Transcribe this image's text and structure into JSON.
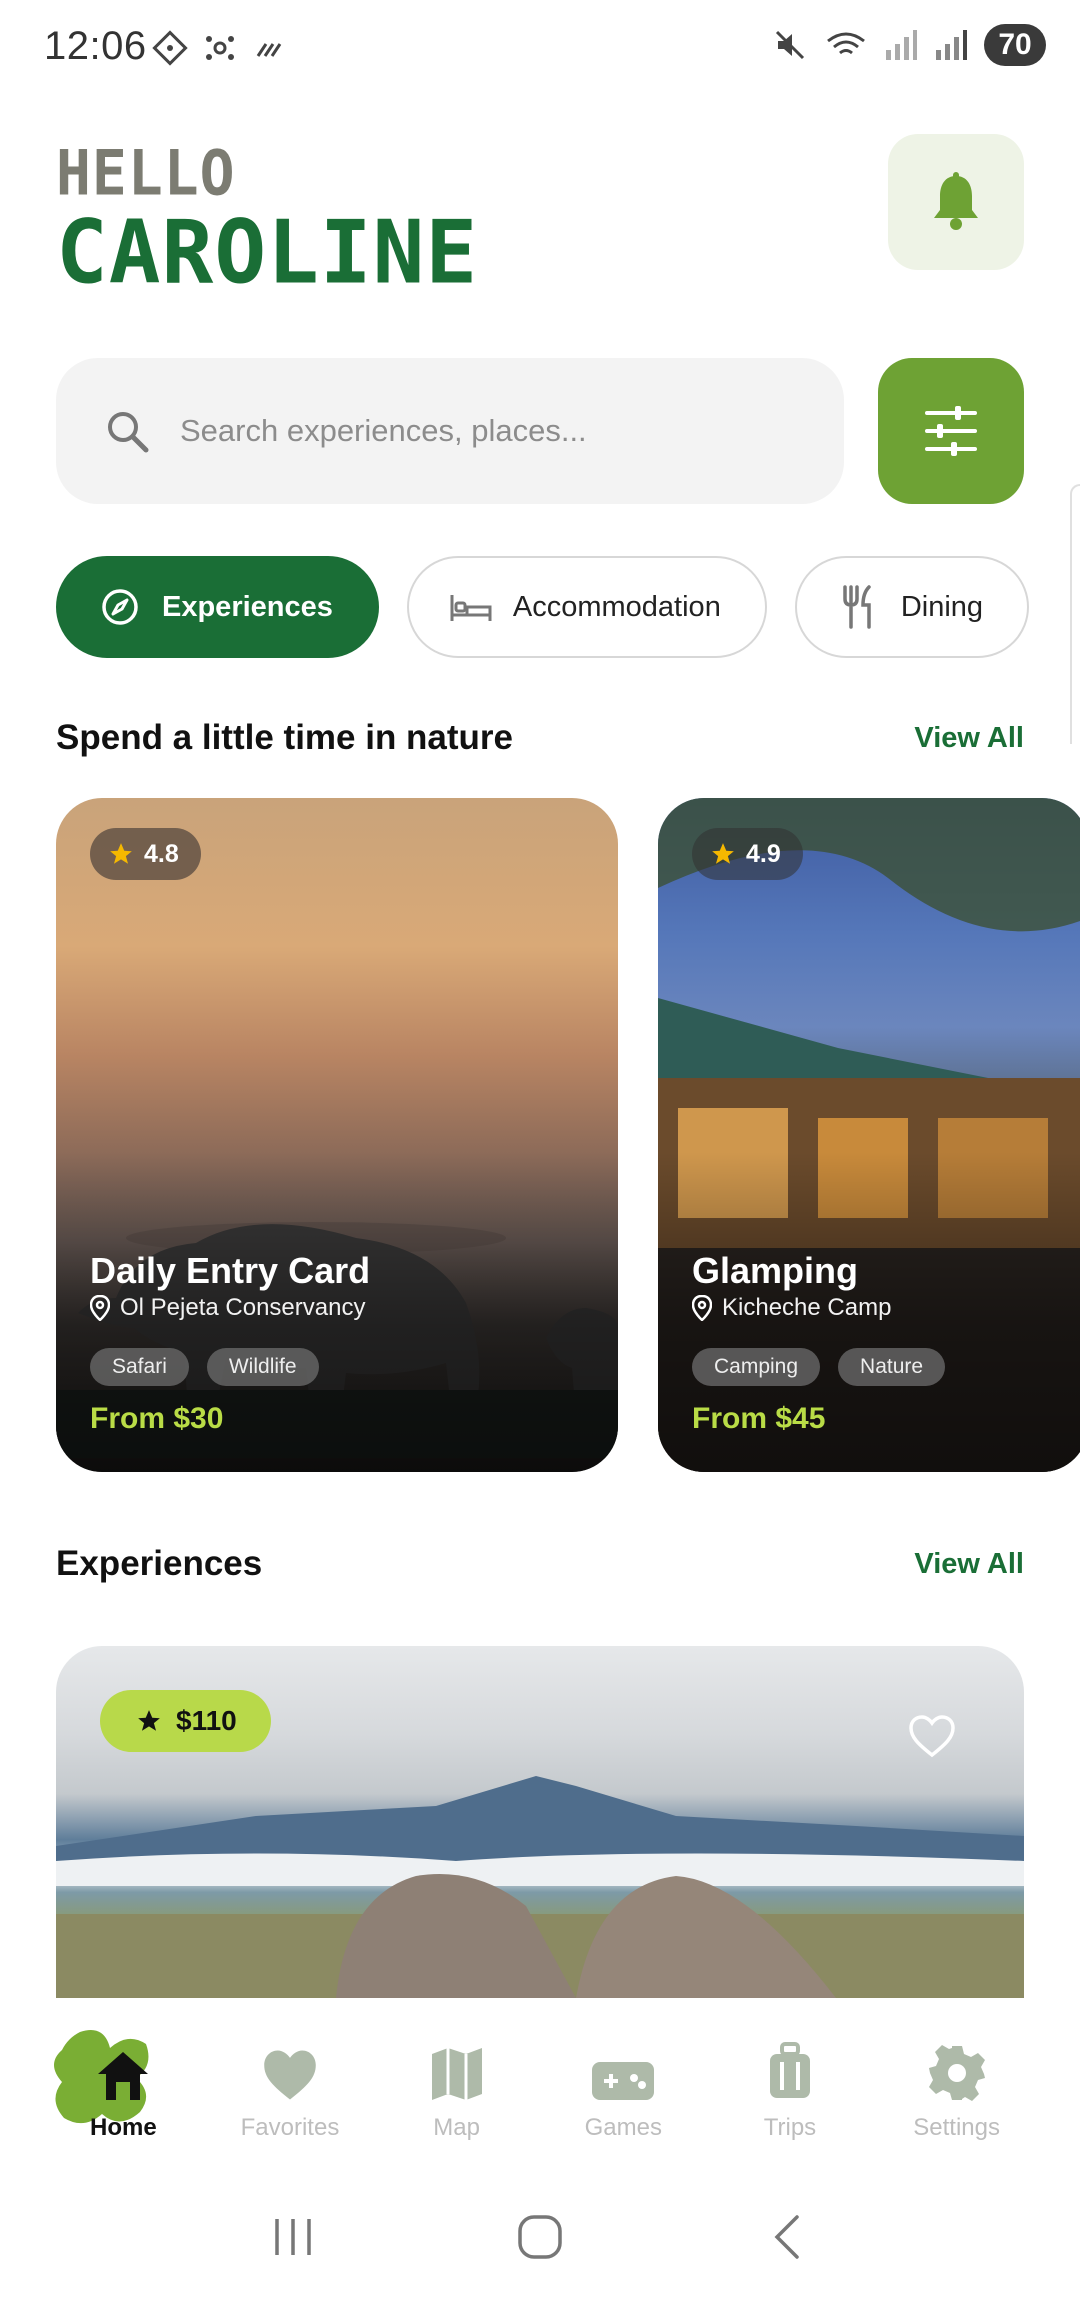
{
  "status_bar": {
    "time": "12:06",
    "battery": "70"
  },
  "greeting": {
    "hello": "HELLO",
    "name": "CAROLINE"
  },
  "search": {
    "placeholder": "Search experiences, places..."
  },
  "chips": [
    {
      "label": "Experiences",
      "icon": "compass-icon",
      "active": true
    },
    {
      "label": "Accommodation",
      "icon": "bed-icon",
      "active": false
    },
    {
      "label": "Dining",
      "icon": "fork-knife-icon",
      "active": false
    }
  ],
  "section_nature": {
    "title": "Spend a little time in nature",
    "view_all": "View All"
  },
  "cards": [
    {
      "rating": "4.8",
      "title": "Daily Entry Card",
      "location": "Ol Pejeta Conservancy",
      "tags": [
        "Safari",
        "Wildlife"
      ],
      "price": "From $30"
    },
    {
      "rating": "4.9",
      "title": "Glamping",
      "location": "Kicheche Camp",
      "tags": [
        "Camping",
        "Nature"
      ],
      "price": "From $45"
    }
  ],
  "section_experiences": {
    "title": "Experiences",
    "view_all": "View All"
  },
  "hero": {
    "price": "$110"
  },
  "bottom_nav": [
    {
      "label": "Home",
      "icon": "home-icon",
      "active": true
    },
    {
      "label": "Favorites",
      "icon": "heart-icon",
      "active": false
    },
    {
      "label": "Map",
      "icon": "map-icon",
      "active": false
    },
    {
      "label": "Games",
      "icon": "gamepad-icon",
      "active": false
    },
    {
      "label": "Trips",
      "icon": "luggage-icon",
      "active": false
    },
    {
      "label": "Settings",
      "icon": "gear-icon",
      "active": false
    }
  ],
  "colors": {
    "brand_green": "#1a6e36",
    "accent_green": "#6ea234",
    "lime": "#b8d94a"
  }
}
